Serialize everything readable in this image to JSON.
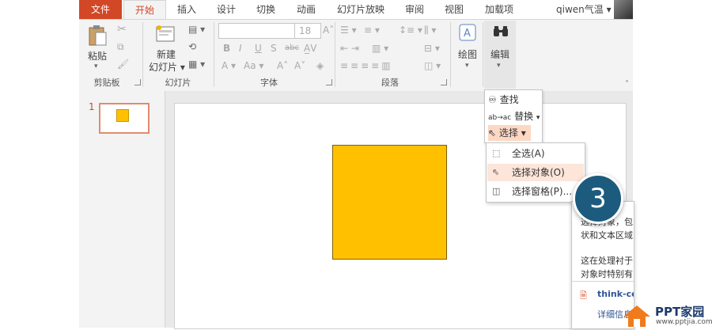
{
  "tabs": {
    "file": "文件",
    "home": "开始",
    "insert": "插入",
    "design": "设计",
    "transitions": "切换",
    "animations": "动画",
    "slideshow": "幻灯片放映",
    "review": "审阅",
    "view": "视图",
    "addins": "加载项"
  },
  "user": {
    "name": "qiwen气温 ▾"
  },
  "ribbon": {
    "clipboard": {
      "paste": "粘贴",
      "label": "剪贴板"
    },
    "slides": {
      "new_line1": "新建",
      "new_line2": "幻灯片 ▾",
      "label": "幻灯片"
    },
    "font": {
      "size": "18",
      "label": "字体"
    },
    "paragraph": {
      "label": "段落"
    },
    "drawing": {
      "label": "绘图"
    },
    "editing": {
      "label": "编辑"
    }
  },
  "slides_panel": {
    "number": "1"
  },
  "edit_menu": {
    "find": "查找",
    "replace": "替换",
    "select": "选择 ▾"
  },
  "select_menu": {
    "select_all": "全选(A)",
    "select_objects": "选择对象(O)",
    "selection_pane": "选择窗格(P)..."
  },
  "tooltip": {
    "line1": "选择对象，包",
    "line2": "状和文本区域",
    "line3": "这在处理衬于",
    "line4": "对象时特别有",
    "link": "think-ce",
    "more": "详细信息"
  },
  "step_badge": "3",
  "watermark": {
    "title": "PPT家园",
    "url": "www.pptjia.com"
  },
  "colors": {
    "accent": "#d24726",
    "shape_fill": "#ffc000",
    "badge": "#1c5b7e"
  }
}
